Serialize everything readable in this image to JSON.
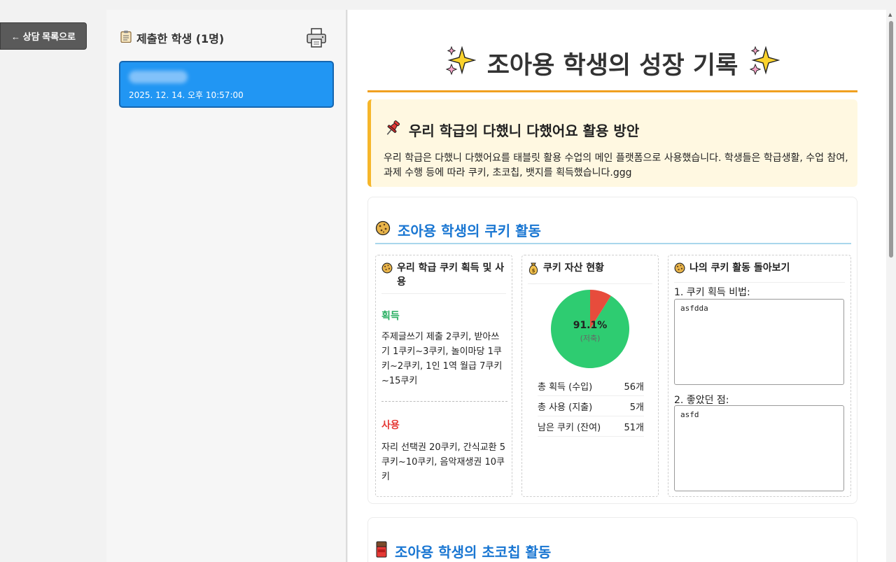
{
  "back_button": {
    "label": "← 상담 목록으로"
  },
  "submitted": {
    "title": "제출한 학생 (1명)",
    "icon": "clipboard-icon",
    "print_icon": "printer-icon"
  },
  "students": [
    {
      "name": "",
      "date": "2025. 12. 14. 오후 10:57:00"
    }
  ],
  "report": {
    "title": "조아용 학생의 성장 기록",
    "notice_title": "우리 학급의 다했니 다했어요 활용 방안",
    "notice_text": "우리 학급은 다했니 다했어요를 태블릿 활용 수업의 메인 플랫폼으로 사용했습니다. 학생들은 학급생활, 수업 참여, 과제 수행 등에 따라 쿠키, 초코칩, 뱃지를 획득했습니다.ggg"
  },
  "cookie": {
    "section_title": "조아용 학생의 쿠키 활동",
    "card1_title": "우리 학급 쿠키 획득 및 사용",
    "earn_label": "획득",
    "earn_text": "주제글쓰기 제출 2쿠키, 받아쓰기 1쿠키~3쿠키, 놀이마당 1쿠키~2쿠키, 1인 1역 월급 7쿠키~15쿠키",
    "use_label": "사용",
    "use_text": "자리 선택권 20쿠키, 간식교환 5쿠키~10쿠키, 음악재생권 10쿠키",
    "card2_title": "쿠키 자산 현황",
    "pie_percent": "91.1%",
    "pie_sub": "(저축)",
    "stats": [
      {
        "label": "총 획득 (수입)",
        "value": "56개"
      },
      {
        "label": "총 사용 (지출)",
        "value": "5개"
      },
      {
        "label": "남은 쿠키 (잔여)",
        "value": "51개"
      }
    ],
    "card3_title": "나의 쿠키 활동 돌아보기",
    "q1_label": "1. 쿠키 획득 비법:",
    "q1_value": "asfdda",
    "q2_label": "2. 좋았던 점:",
    "q2_value": "asfd"
  },
  "chocochip": {
    "section_title": "조아용 학생의 초코칩 활동"
  },
  "colors": {
    "accent": "#2196f3",
    "title_rule": "#f0a020",
    "notice_bg": "#fff8e1",
    "section_title": "#1976d2",
    "earn": "#27ae60",
    "use": "#e53935",
    "pie_saved": "#2ecc71",
    "pie_spent": "#e74c3c"
  },
  "chart_data": {
    "type": "pie",
    "categories": [
      "저축",
      "사용"
    ],
    "values": [
      51,
      5
    ]
  }
}
